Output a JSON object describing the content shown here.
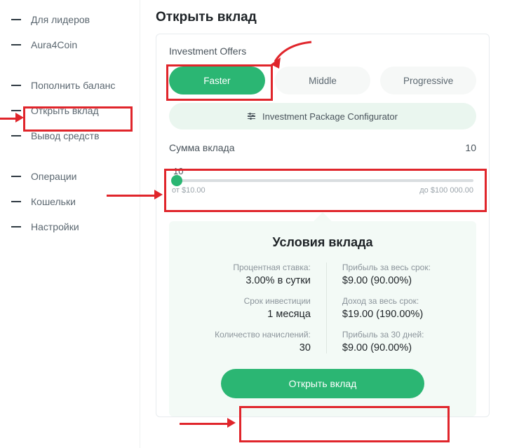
{
  "sidebar": {
    "groups": [
      [
        "Для лидеров",
        "Aura4Coin"
      ],
      [
        "Пополнить баланс",
        "Открыть вклад",
        "Вывод средств"
      ],
      [
        "Операции",
        "Кошельки",
        "Настройки"
      ]
    ]
  },
  "page": {
    "title": "Открыть вклад"
  },
  "offers": {
    "label": "Investment Offers",
    "tabs": [
      "Faster",
      "Middle",
      "Progressive"
    ],
    "configurator": "Investment Package Configurator"
  },
  "amount": {
    "label": "Сумма вклада",
    "value": "10",
    "slider_value": "10",
    "min_text": "от $10.00",
    "max_text": "до $100 000.00"
  },
  "terms": {
    "title": "Условия вклада",
    "left": [
      {
        "label": "Процентная ставка:",
        "value": "3.00% в сутки"
      },
      {
        "label": "Срок инвестиции",
        "value": "1 месяца"
      },
      {
        "label": "Количество начислений:",
        "value": "30"
      }
    ],
    "right": [
      {
        "label": "Прибыль за весь срок:",
        "value": "$9.00 (90.00%)"
      },
      {
        "label": "Доход за весь срок:",
        "value": "$19.00 (190.00%)"
      },
      {
        "label": "Прибыль за 30 дней:",
        "value": "$9.00 (90.00%)"
      }
    ]
  },
  "button": {
    "open": "Открыть вклад"
  }
}
